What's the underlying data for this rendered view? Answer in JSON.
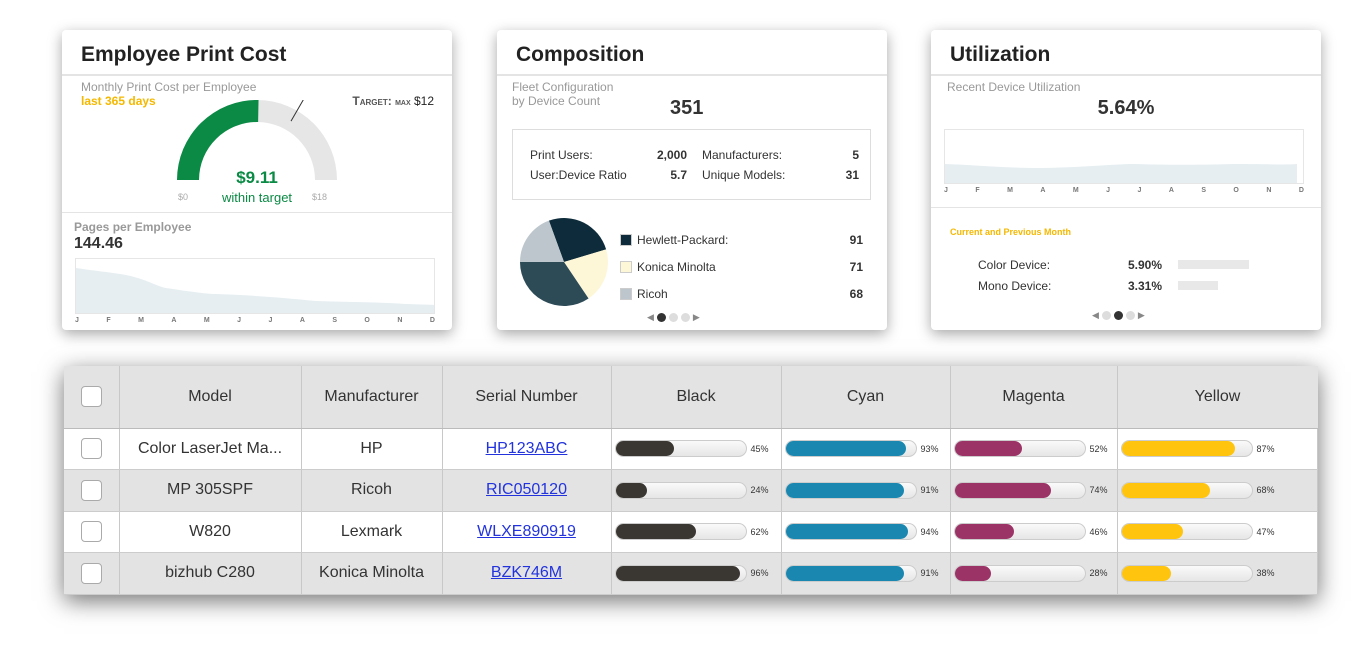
{
  "cost": {
    "title": "Employee Print Cost",
    "subtitle": "Monthly Print Cost per Employee",
    "period": "last 365 days",
    "target_label": "Target:",
    "target_max": "max",
    "target_value": "$12",
    "value": "$9.11",
    "value_num": 9.11,
    "status": "within target",
    "min": "$0",
    "max": "$18",
    "min_num": 0,
    "max_num": 18,
    "target_num": 12,
    "pages_label": "Pages per Employee",
    "pages_value": "144.46",
    "months": [
      "J",
      "F",
      "M",
      "A",
      "M",
      "J",
      "J",
      "A",
      "S",
      "O",
      "N",
      "D"
    ],
    "colors": {
      "good": "#0a8a44",
      "period": "#f5b800"
    }
  },
  "composition": {
    "title": "Composition",
    "subtitle1": "Fleet Configuration",
    "subtitle2": "by Device Count",
    "total": "351",
    "stats": [
      {
        "label": "Print Users:",
        "value": "2,000"
      },
      {
        "label": "Manufacturers:",
        "value": "5"
      },
      {
        "label": "User:Device Ratio",
        "value": "5.7"
      },
      {
        "label": "Unique Models:",
        "value": "31"
      }
    ],
    "legend": [
      {
        "name": "Hewlett-Packard:",
        "value": 91,
        "color": "#0d2b3a"
      },
      {
        "name": "Konica Minolta",
        "value": 71,
        "color": "#fdf7d8"
      },
      {
        "name": "Ricoh",
        "value": 68,
        "color": "#bcc6cc"
      }
    ],
    "other_slice_color": "#2d4a57",
    "page": 1,
    "pages": 3
  },
  "utilization": {
    "title": "Utilization",
    "subtitle": "Recent Device Utilization",
    "value": "5.64%",
    "months": [
      "J",
      "F",
      "M",
      "A",
      "M",
      "J",
      "J",
      "A",
      "S",
      "O",
      "N",
      "D"
    ],
    "period_label": "Current and Previous Month",
    "rows": [
      {
        "label": "Color Device:",
        "value": "5.90%",
        "pct": 5.9
      },
      {
        "label": "Mono Device:",
        "value": "3.31%",
        "pct": 3.31
      }
    ],
    "page": 2,
    "pages": 3
  },
  "table": {
    "headers": [
      "Model",
      "Manufacturer",
      "Serial Number",
      "Black",
      "Cyan",
      "Magenta",
      "Yellow"
    ],
    "colors": {
      "black": "#3a3632",
      "cyan": "#1a87b0",
      "magenta": "#9b3366",
      "yellow": "#ffc40d"
    },
    "rows": [
      {
        "model": "Color LaserJet Ma...",
        "manufacturer": "HP",
        "serial": "HP123ABC",
        "black": "45%",
        "cyan": "93%",
        "magenta": "52%",
        "yellow": "87%"
      },
      {
        "model": "MP 305SPF",
        "manufacturer": "Ricoh",
        "serial": "RIC050120",
        "black": "24%",
        "cyan": "91%",
        "magenta": "74%",
        "yellow": "68%"
      },
      {
        "model": "W820",
        "manufacturer": "Lexmark",
        "serial": "WLXE890919",
        "black": "62%",
        "cyan": "94%",
        "magenta": "46%",
        "yellow": "47%"
      },
      {
        "model": "bizhub C280",
        "manufacturer": "Konica Minolta",
        "serial": "BZK746M",
        "black": "96%",
        "cyan": "91%",
        "magenta": "28%",
        "yellow": "38%"
      }
    ]
  }
}
